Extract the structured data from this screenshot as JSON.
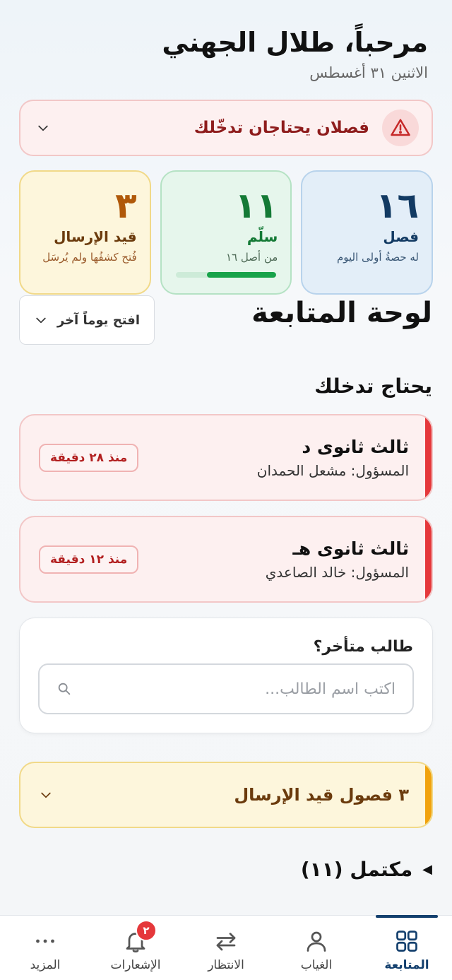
{
  "header": {
    "greeting": "مرحباً، طلال الجهني",
    "date": "الاثنين ٣١ أغسطس"
  },
  "alert": {
    "text": "فصلان يحتاجان تدخّلك",
    "icon": "warning-triangle-icon",
    "color": "#e5383b"
  },
  "stats": [
    {
      "value": "١٦",
      "label": "فصل",
      "sub": "له حصةُ أولى اليوم",
      "color": "#123a63"
    },
    {
      "value": "١١",
      "label": "سلّم",
      "sub": "من أصل ١٦",
      "progress": 0.69,
      "color": "#147a36"
    },
    {
      "value": "٣",
      "label": "قيد الإرسال",
      "sub": "فُتح كشفُها ولم يُرسَل",
      "color": "#b0590a"
    }
  ],
  "dashboard": {
    "title": "لوحة المتابعة",
    "other_day_label": "افتح يوماً آخر"
  },
  "intervention": {
    "title": "يحتاج تدخلك",
    "items": [
      {
        "title": "ثالث ثانوى د",
        "sub": "المسؤول: مشعل الحمدان",
        "badge": "منذ ٢٨ دقيقة"
      },
      {
        "title": "ثالث ثانوى هـ",
        "sub": "المسؤول: خالد الصاعدي",
        "badge": "منذ ١٢ دقيقة"
      }
    ]
  },
  "late_student": {
    "title": "طالب متأخر؟",
    "placeholder": "اكتب اسم الطالب..."
  },
  "pending": {
    "text": "٣ فصول قيد الإرسال"
  },
  "completed": {
    "text": "مكتمل (١١)"
  },
  "bottom_nav": {
    "items": [
      {
        "label": "المتابعة",
        "icon": "grid-icon",
        "active": true
      },
      {
        "label": "الغياب",
        "icon": "person-icon",
        "active": false
      },
      {
        "label": "الانتظار",
        "icon": "swap-arrows-icon",
        "active": false
      },
      {
        "label": "الإشعارات",
        "icon": "bell-icon",
        "active": false,
        "badge": "٢"
      },
      {
        "label": "المزيد",
        "icon": "more-dots-icon",
        "active": false
      }
    ]
  }
}
